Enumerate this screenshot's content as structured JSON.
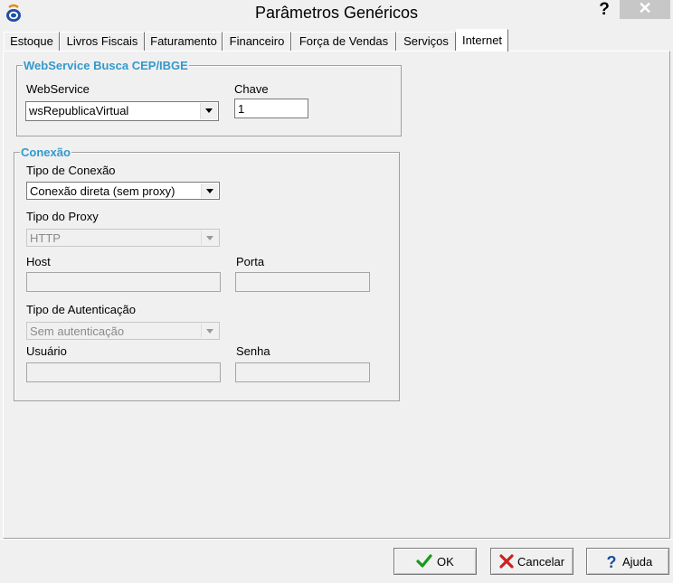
{
  "window": {
    "title": "Parâmetros Genéricos",
    "help_glyph": "?",
    "close_glyph": "✕"
  },
  "tabs": [
    {
      "label": "Estoque",
      "active": false
    },
    {
      "label": "Livros Fiscais",
      "active": false
    },
    {
      "label": "Faturamento",
      "active": false
    },
    {
      "label": "Financeiro",
      "active": false
    },
    {
      "label": "Força de Vendas",
      "active": false
    },
    {
      "label": "Serviços",
      "active": false
    },
    {
      "label": "Internet",
      "active": true
    }
  ],
  "webservice_group": {
    "legend": "WebService Busca CEP/IBGE",
    "webservice_label": "WebService",
    "webservice_value": "wsRepublicaVirtual",
    "chave_label": "Chave",
    "chave_value": "1"
  },
  "conexao_group": {
    "legend": "Conexão",
    "tipo_conexao_label": "Tipo de Conexão",
    "tipo_conexao_value": "Conexão direta (sem proxy)",
    "tipo_proxy_label": "Tipo do Proxy",
    "tipo_proxy_value": "HTTP",
    "host_label": "Host",
    "host_value": "",
    "porta_label": "Porta",
    "porta_value": "",
    "tipo_autenticacao_label": "Tipo de Autenticação",
    "tipo_autenticacao_value": "Sem autenticação",
    "usuario_label": "Usuário",
    "usuario_value": "",
    "senha_label": "Senha",
    "senha_value": ""
  },
  "buttons": {
    "ok": "OK",
    "cancelar": "Cancelar",
    "ajuda": "Ajuda"
  },
  "colors": {
    "legend": "#3399cc",
    "ok_icon": "#1a9a1a",
    "cancel_icon": "#cc2222",
    "help_icon": "#1a4fa0"
  }
}
